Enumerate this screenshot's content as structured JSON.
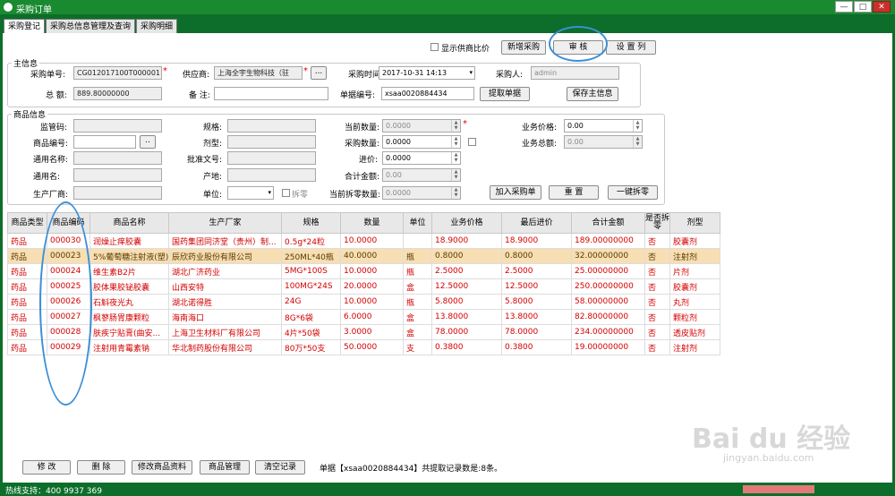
{
  "window": {
    "title": "采购订单",
    "min": "—",
    "max": "□",
    "close": "✕"
  },
  "tabs": [
    "采购登记",
    "采购总信息管理及查询",
    "采购明细"
  ],
  "toolbar": {
    "show_ratio_label": "显示供商比价",
    "new_button": "新增采购",
    "audit_button": "审  核",
    "settings_button": "设 置 列"
  },
  "main_info": {
    "group_title": "主信息",
    "order_no_label": "采购单号:",
    "order_no": "CG012017100T000001",
    "supplier_label": "供应商:",
    "supplier": "上海全宇生物科技（驻",
    "supplier_more": "...",
    "time_label": "采购时间:",
    "time": "2017-10-31 14:13",
    "buyer_label": "采购人:",
    "buyer": "admin",
    "total_label": "总  额:",
    "total": "889.80000000",
    "remark_label": "备  注:",
    "remark": "",
    "doc_no_label": "单据编号:",
    "doc_no": "xsaa0020884434",
    "fetch_button": "提取单据",
    "save_button": "保存主信息"
  },
  "product_info": {
    "group_title": "商品信息",
    "supervise_code_label": "监管码:",
    "code_label": "商品编号:",
    "code_more": "..",
    "common_name_label": "通用名称:",
    "alias_label": "通用名:",
    "maker_label": "生产厂商:",
    "spec_label": "规格:",
    "form_label": "剂型:",
    "approval_label": "批准文号:",
    "origin_label": "产地:",
    "unit_label": "单位:",
    "split_label": "拆零",
    "cur_qty_label": "当前数量:",
    "cur_qty": "0.0000",
    "buy_qty_label": "采购数量:",
    "buy_qty": "0.0000",
    "in_price_label": "进价:",
    "in_price": "0.0000",
    "sum_label": "合计金额:",
    "sum": "0.00",
    "split_qty_label": "当前拆零数量:",
    "split_qty": "0.0000",
    "biz_price_label": "业务价格:",
    "biz_price": "0.00",
    "biz_total_label": "业务总额:",
    "biz_total": "0.00",
    "add_button": "加入采购单",
    "reset_button": "重 置",
    "onekey_button": "一键拆零"
  },
  "grid": {
    "headers": [
      "商品类型",
      "商品编码",
      "商品名称",
      "生产厂家",
      "规格",
      "数量",
      "单位",
      "业务价格",
      "最后进价",
      "合计金额",
      "是否拆零",
      "剂型"
    ],
    "rows": [
      [
        "药品",
        "000030",
        "润燥止痒胶囊",
        "国药集团同济堂（贵州）制...",
        "0.5g*24粒",
        "10.0000",
        "",
        "18.9000",
        "18.9000",
        "189.00000000",
        "否",
        "胶囊剂"
      ],
      [
        "药品",
        "000023",
        "5%葡萄糖注射液(塑)",
        "辰欣药业股份有限公司",
        "250ML*40瓶",
        "40.0000",
        "瓶",
        "0.8000",
        "0.8000",
        "32.00000000",
        "否",
        "注射剂"
      ],
      [
        "药品",
        "000024",
        "维生素B2片",
        "湖北广济药业",
        "5MG*100S",
        "10.0000",
        "瓶",
        "2.5000",
        "2.5000",
        "25.00000000",
        "否",
        "片剂"
      ],
      [
        "药品",
        "000025",
        "胶体果胶铋胶囊",
        "山西安特",
        "100MG*24S",
        "20.0000",
        "盒",
        "12.5000",
        "12.5000",
        "250.00000000",
        "否",
        "胶囊剂"
      ],
      [
        "药品",
        "000026",
        "石斛夜光丸",
        "湖北诺得胜",
        "24G",
        "10.0000",
        "瓶",
        "5.8000",
        "5.8000",
        "58.00000000",
        "否",
        "丸剂"
      ],
      [
        "药品",
        "000027",
        "枫蓼肠胃康颗粒",
        "海南海口",
        "8G*6袋",
        "6.0000",
        "盒",
        "13.8000",
        "13.8000",
        "82.80000000",
        "否",
        "颗粒剂"
      ],
      [
        "药品",
        "000028",
        "肤疾宁贴膏(曲安...",
        "上海卫生材料厂有限公司",
        "4片*50袋",
        "3.0000",
        "盒",
        "78.0000",
        "78.0000",
        "234.00000000",
        "否",
        "透皮贴剂"
      ],
      [
        "药品",
        "000029",
        "注射用青霉素钠",
        "华北制药股份有限公司",
        "80万*50支",
        "50.0000",
        "支",
        "0.3800",
        "0.3800",
        "19.00000000",
        "否",
        "注射剂"
      ]
    ]
  },
  "bottom": {
    "edit_button": "修 改",
    "delete_button": "删 除",
    "edit_product_button": "修改商品资料",
    "product_mgmt_button": "商品管理",
    "clear_button": "清空记录",
    "summary": "单据【xsaa0020884434】共提取记录数是:8条。"
  },
  "status": {
    "hotline": "热线支持：400 9937 369"
  },
  "watermark": {
    "brand": "Bai du 经验",
    "url": "jingyan.baidu.com"
  },
  "colors": {
    "frame": "#0c6e2a",
    "row_text": "#d40000",
    "selected_row": "#f7deb3",
    "annotation": "#3c8fd6"
  }
}
